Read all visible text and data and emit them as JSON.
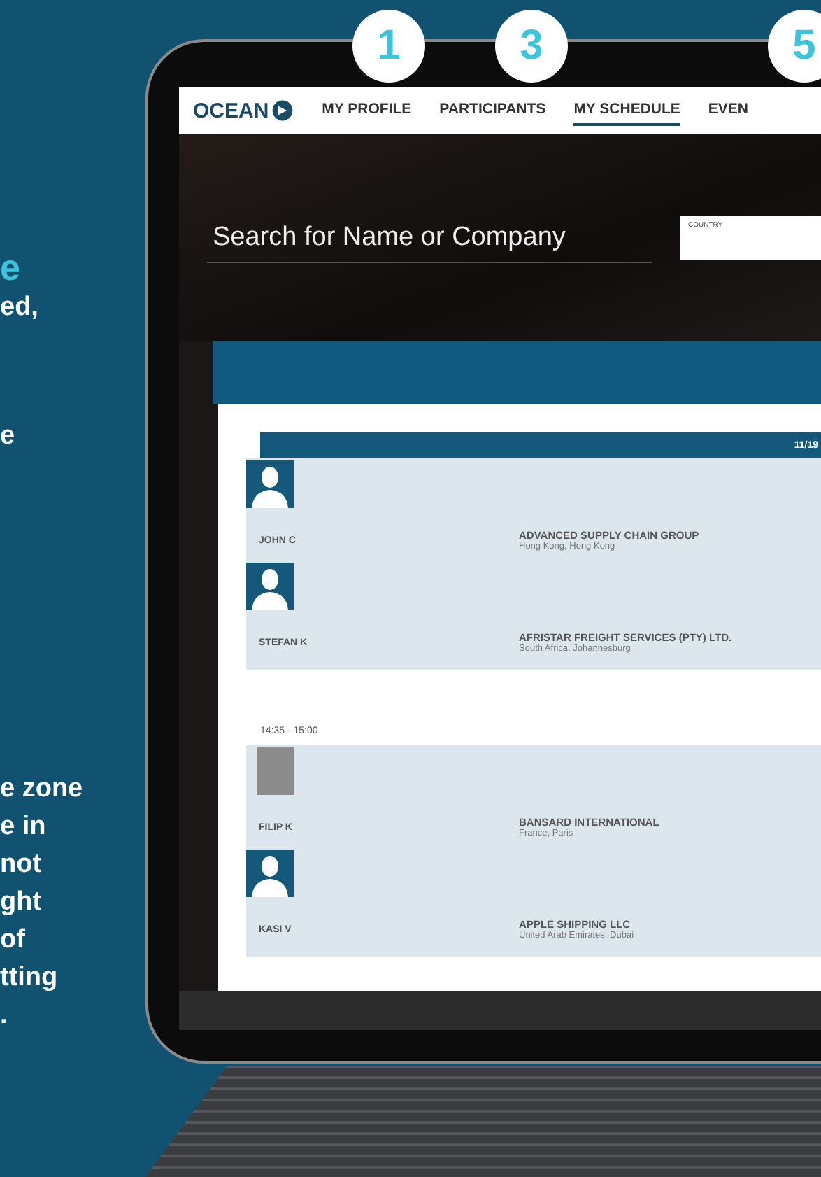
{
  "side_text": {
    "heading": "e",
    "blocks": [
      "ed,",
      "e",
      "e zone\ne in\nnot\nght\nof\ntting\n."
    ]
  },
  "step_badges": [
    {
      "label": "1"
    },
    {
      "label": "3"
    },
    {
      "label": "5"
    }
  ],
  "nav": {
    "logo": "OCEAN",
    "tabs": [
      {
        "label": "MY PROFILE",
        "selected": false
      },
      {
        "label": "PARTICIPANTS",
        "selected": false
      },
      {
        "label": "MY SCHEDULE",
        "selected": true
      },
      {
        "label": "EVEN",
        "selected": false
      }
    ]
  },
  "search": {
    "placeholder": "Search for Name or Company",
    "country_label": "COUNTRY"
  },
  "schedule": {
    "date": "11/19",
    "sessions": [
      {
        "participants": [
          {
            "kind": "silhouette",
            "name": "JOHN C",
            "company": "ADVANCED SUPPLY CHAIN GROUP",
            "location": "Hong Kong, Hong Kong"
          },
          {
            "kind": "silhouette",
            "name": "STEFAN K",
            "company": "AFRISTAR FREIGHT SERVICES (PTY) LTD.",
            "location": "South Africa, Johannesburg"
          }
        ]
      },
      {
        "time": "14:35 - 15:00",
        "participants": [
          {
            "kind": "photo",
            "name": "FILIP K",
            "company": "BANSARD INTERNATIONAL",
            "location": "France, Paris"
          },
          {
            "kind": "silhouette",
            "name": "KASI V",
            "company": "APPLE SHIPPING LLC",
            "location": "United Arab Emirates, Dubai"
          }
        ]
      }
    ]
  }
}
